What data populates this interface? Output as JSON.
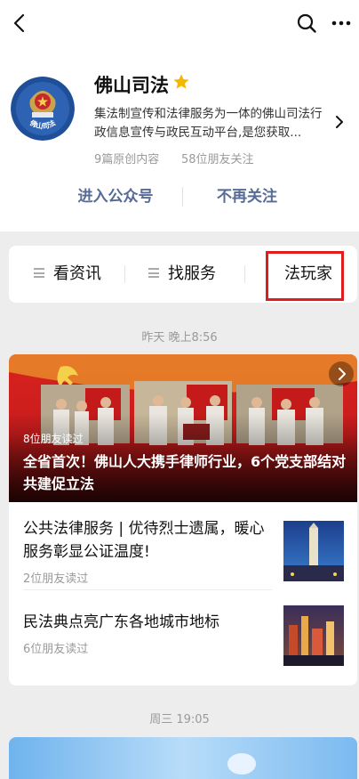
{
  "nav": {
    "back_icon": "chevron-left-icon",
    "search_icon": "search-icon",
    "more_icon": "more-icon"
  },
  "account": {
    "name": "佛山司法",
    "badge_icon": "star-icon",
    "description": "集法制宣传和法律服务为一体的佛山司法行政信息宣传与政民互动平台,是您获取...",
    "original_count": "9篇原创内容",
    "friends_following": "58位朋友关注",
    "avatar_text": "佛山司法"
  },
  "actions": {
    "enter": "进入公众号",
    "unfollow": "不再关注"
  },
  "menu": [
    {
      "label": "看资讯"
    },
    {
      "label": "找服务"
    },
    {
      "label": "法玩家"
    }
  ],
  "feed": [
    {
      "time": "昨天 晚上8:56",
      "hero": {
        "reads": "8位朋友读过",
        "title": "全省首次！佛山人大携手律师行业，6个党支部结对共建促立法"
      },
      "items": [
        {
          "title": "公共法律服务 | 优待烈士遗属，暖心服务彰显公证温度!",
          "reads": "2位朋友读过"
        },
        {
          "title": "民法典点亮广东各地城市地标",
          "reads": "6位朋友读过"
        }
      ]
    },
    {
      "time": "周三 19:05"
    }
  ],
  "colors": {
    "link": "#576b95",
    "highlight": "#e01d1d",
    "gold": "#f5b800"
  }
}
